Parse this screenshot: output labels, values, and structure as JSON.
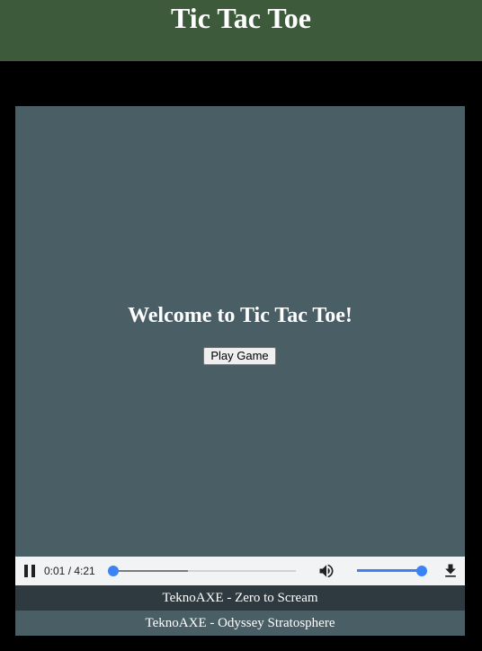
{
  "header": {
    "title": "Tic Tac Toe"
  },
  "game": {
    "welcome": "Welcome to Tic Tac Toe!",
    "play_button": "Play Game"
  },
  "audio_player": {
    "state": "playing",
    "pause_icon": "pause-icon",
    "time_display": "0:01 / 4:21",
    "current_time": "0:01",
    "duration": "4:21",
    "progress_fraction": 0.004,
    "buffered_fraction": 0.41,
    "volume_icon": "volume-icon",
    "volume_fraction": 1.0,
    "download_icon": "download-icon",
    "accent_color": "#3b82f6"
  },
  "playlist": [
    {
      "label": "TeknoAXE - Zero to Scream",
      "active": true
    },
    {
      "label": "TeknoAXE - Odyssey Stratosphere",
      "active": false
    }
  ],
  "colors": {
    "header_bg": "#3d5a3a",
    "panel_bg": "#4a5e66",
    "active_track_bg": "#2e3a3f",
    "page_bg": "#000000"
  }
}
